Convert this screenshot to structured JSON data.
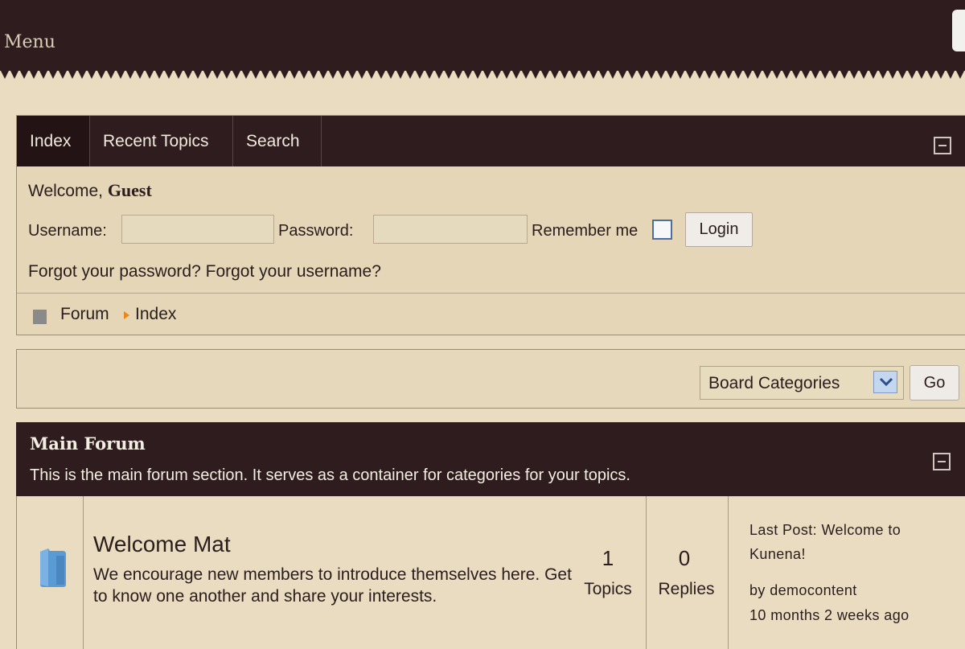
{
  "header": {
    "menu_label": "Menu"
  },
  "nav": {
    "tabs": [
      {
        "label": "Index"
      },
      {
        "label": "Recent Topics"
      },
      {
        "label": "Search"
      }
    ]
  },
  "login": {
    "welcome_prefix": "Welcome, ",
    "welcome_user": "Guest",
    "username_label": "Username:",
    "username_value": "",
    "password_label": "Password:",
    "password_value": "",
    "remember_label": "Remember me",
    "remember_checked": false,
    "login_button": "Login",
    "forgot_password": "Forgot your password?",
    "forgot_username": "Forgot your username?"
  },
  "breadcrumb": {
    "items": [
      "Forum",
      "Index"
    ]
  },
  "category_jump": {
    "selected": "Board Categories",
    "go_button": "Go"
  },
  "section": {
    "title": "Main Forum",
    "description": "This is the main forum section. It serves as a container for categories for your topics."
  },
  "categories": [
    {
      "name": "Welcome Mat",
      "description": "We encourage new members to introduce themselves here. Get to know one another and share your interests.",
      "topics_count": "1",
      "topics_label": "Topics",
      "replies_count": "0",
      "replies_label": "Replies",
      "last_post_prefix": "Last Post: ",
      "last_post_title": "Welcome to Kunena!",
      "last_post_by": "by democontent",
      "last_post_time": "10 months 2 weeks ago"
    }
  ],
  "colors": {
    "page_background": "#e9dcc0",
    "dark_header": "#2f1c1e",
    "active_tab": "#231314",
    "breadcrumb_arrow": "#e8881a",
    "folder_icon": "#5b9bd5"
  }
}
